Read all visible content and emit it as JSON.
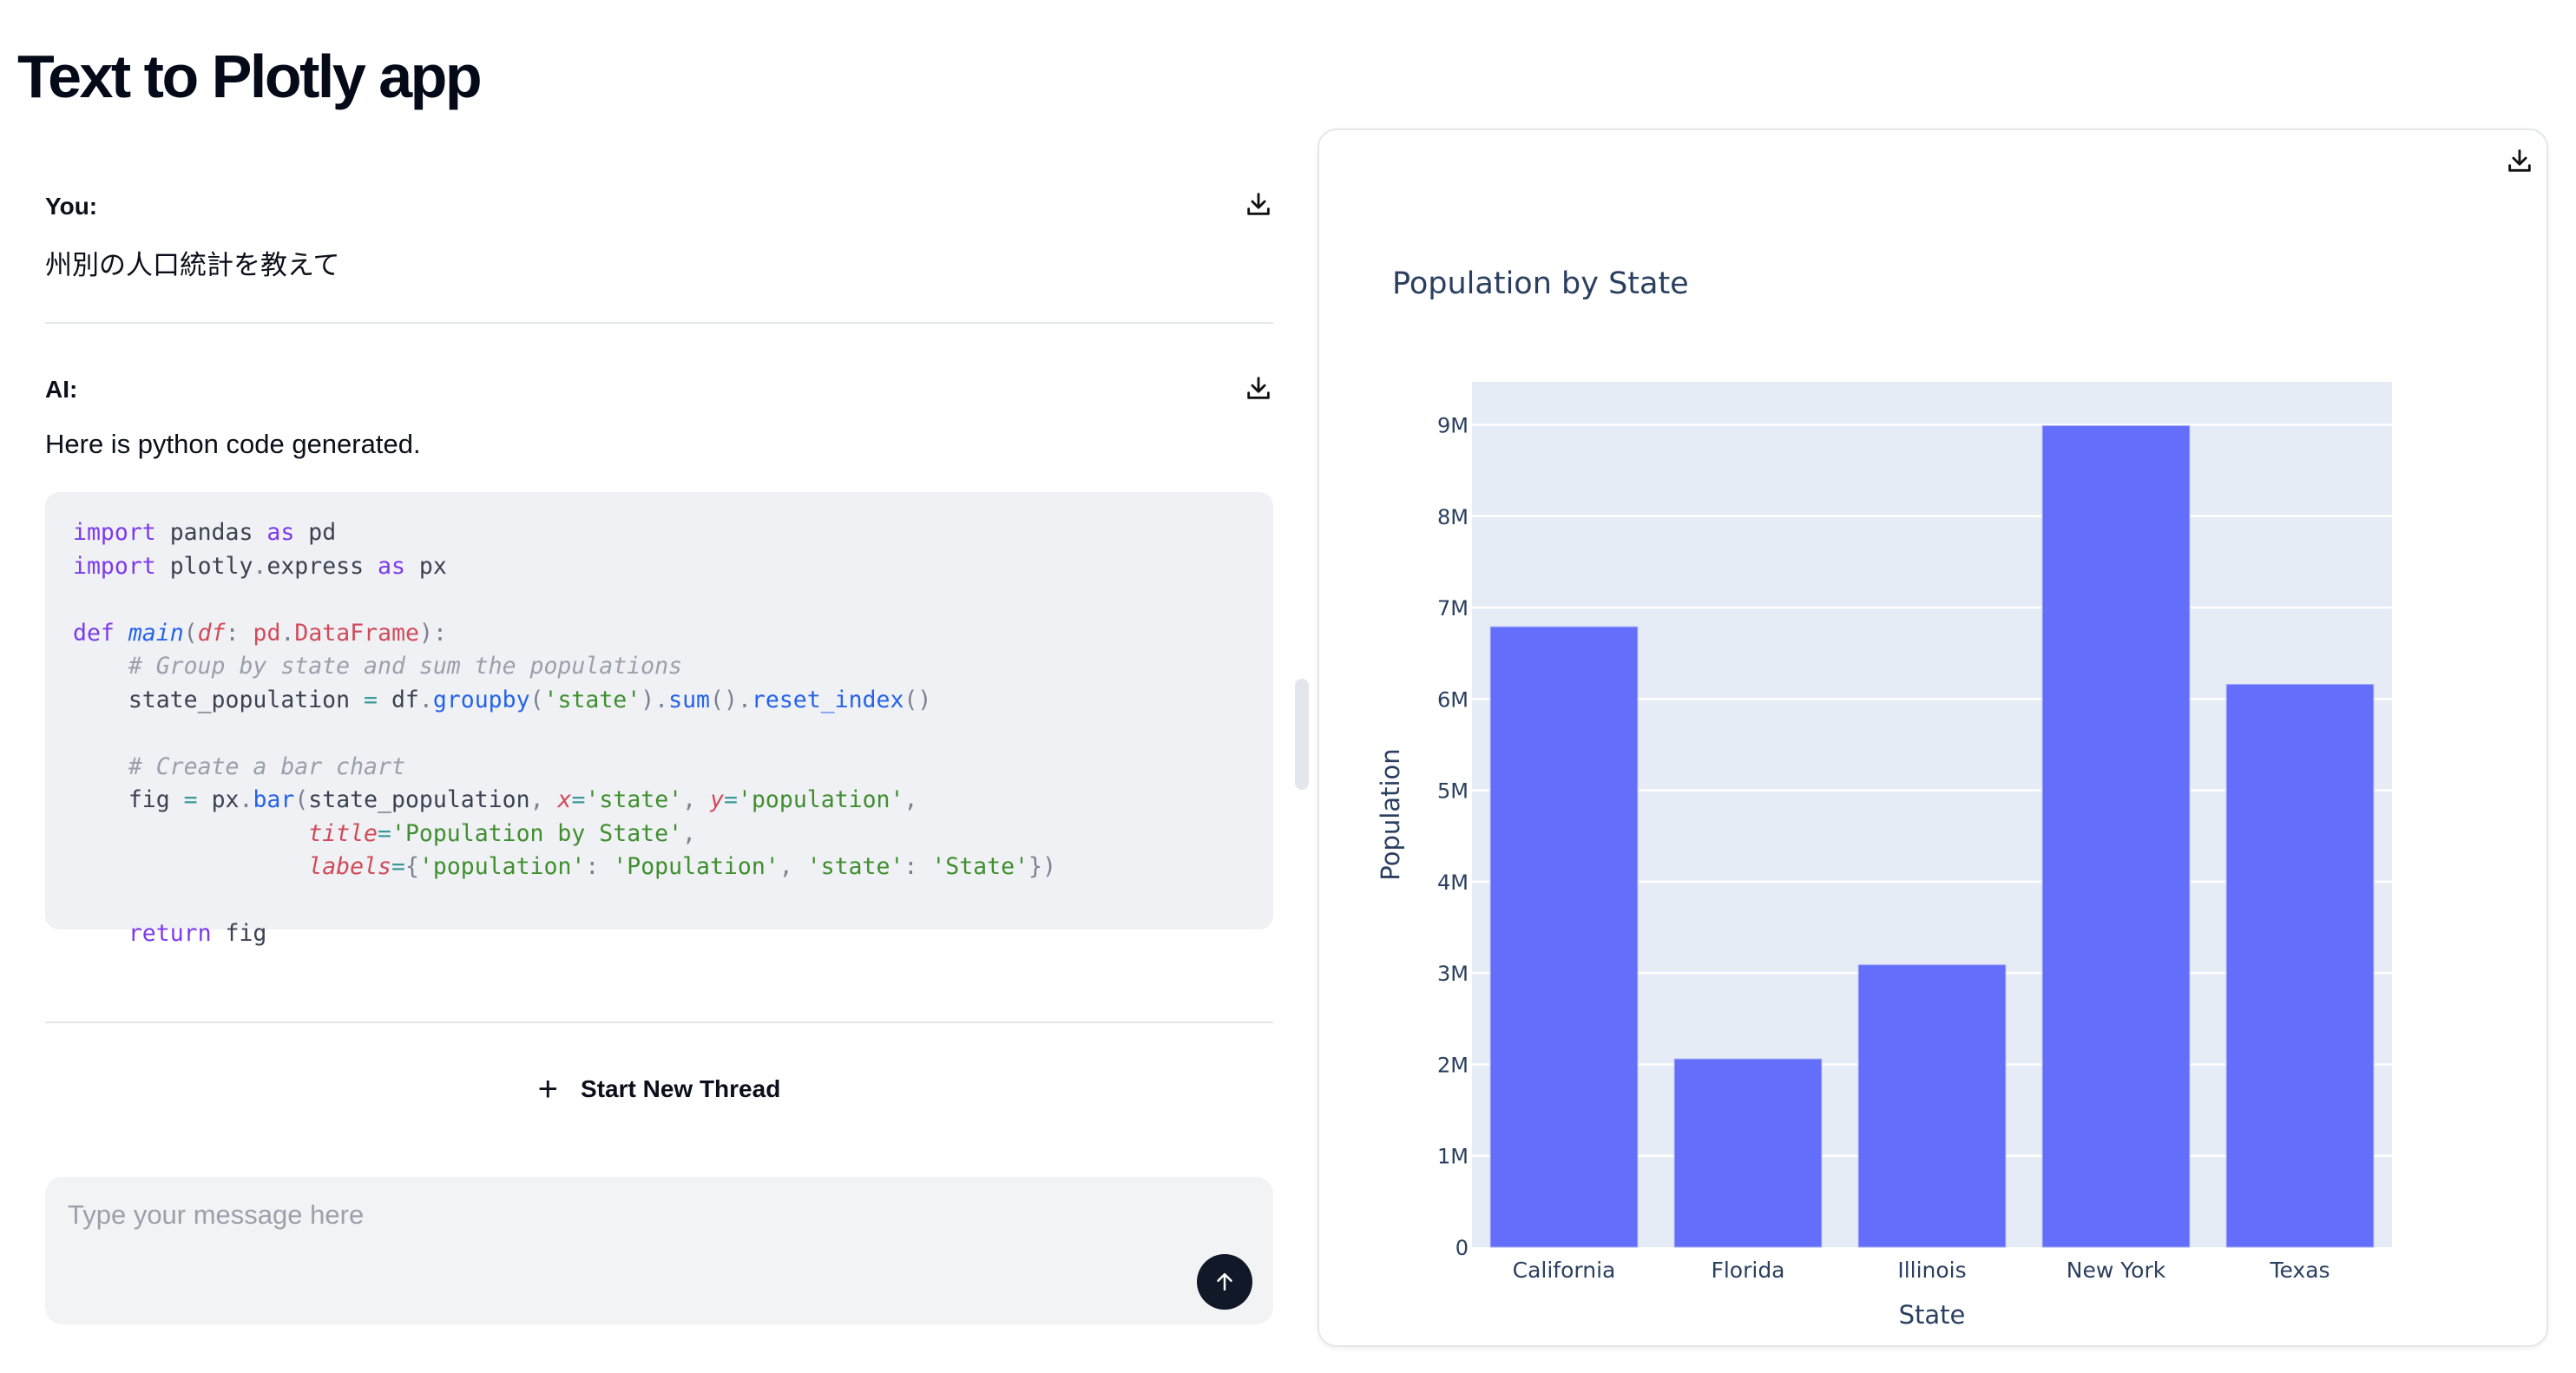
{
  "app": {
    "title": "Text to Plotly app"
  },
  "conversation": {
    "messages": [
      {
        "role": "You:",
        "text": "州別の人口統計を教えて",
        "download_icon": "download-icon"
      },
      {
        "role": "AI:",
        "text": "Here is python code generated.",
        "download_icon": "download-icon",
        "code": {
          "language": "python",
          "lines": [
            "import pandas as pd",
            "import plotly.express as px",
            "",
            "def main(df: pd.DataFrame):",
            "    # Group by state and sum the populations",
            "    state_population = df.groupby('state').sum().reset_index()",
            "",
            "    # Create a bar chart",
            "    fig = px.bar(state_population, x='state', y='population',",
            "                 title='Population by State',",
            "                 labels={'population': 'Population', 'state': 'State'})",
            "",
            "    return fig"
          ]
        }
      }
    ]
  },
  "actions": {
    "new_thread_label": "Start New Thread",
    "new_thread_icon": "plus-icon"
  },
  "composer": {
    "placeholder": "Type your message here",
    "value": "",
    "send_icon": "arrow-up-icon"
  },
  "colors": {
    "bar": "#636efa",
    "plot_bg": "#e5ecf6",
    "send_button": "#111827",
    "axis_text": "#2a3f5f"
  },
  "chart_panel": {
    "download_icon": "download-icon"
  },
  "chart_data": {
    "type": "bar",
    "title": "Population by State",
    "xlabel": "State",
    "ylabel": "Population",
    "categories": [
      "California",
      "Florida",
      "Illinois",
      "New York",
      "Texas"
    ],
    "values": [
      6790000,
      2060000,
      3090000,
      8990000,
      6160000
    ],
    "ylim": [
      0,
      9470000
    ],
    "yticks": [
      0,
      1000000,
      2000000,
      3000000,
      4000000,
      5000000,
      6000000,
      7000000,
      8000000,
      9000000
    ],
    "ytick_labels": [
      "0",
      "1M",
      "2M",
      "3M",
      "4M",
      "5M",
      "6M",
      "7M",
      "8M",
      "9M"
    ],
    "grid": true,
    "legend": "none"
  }
}
